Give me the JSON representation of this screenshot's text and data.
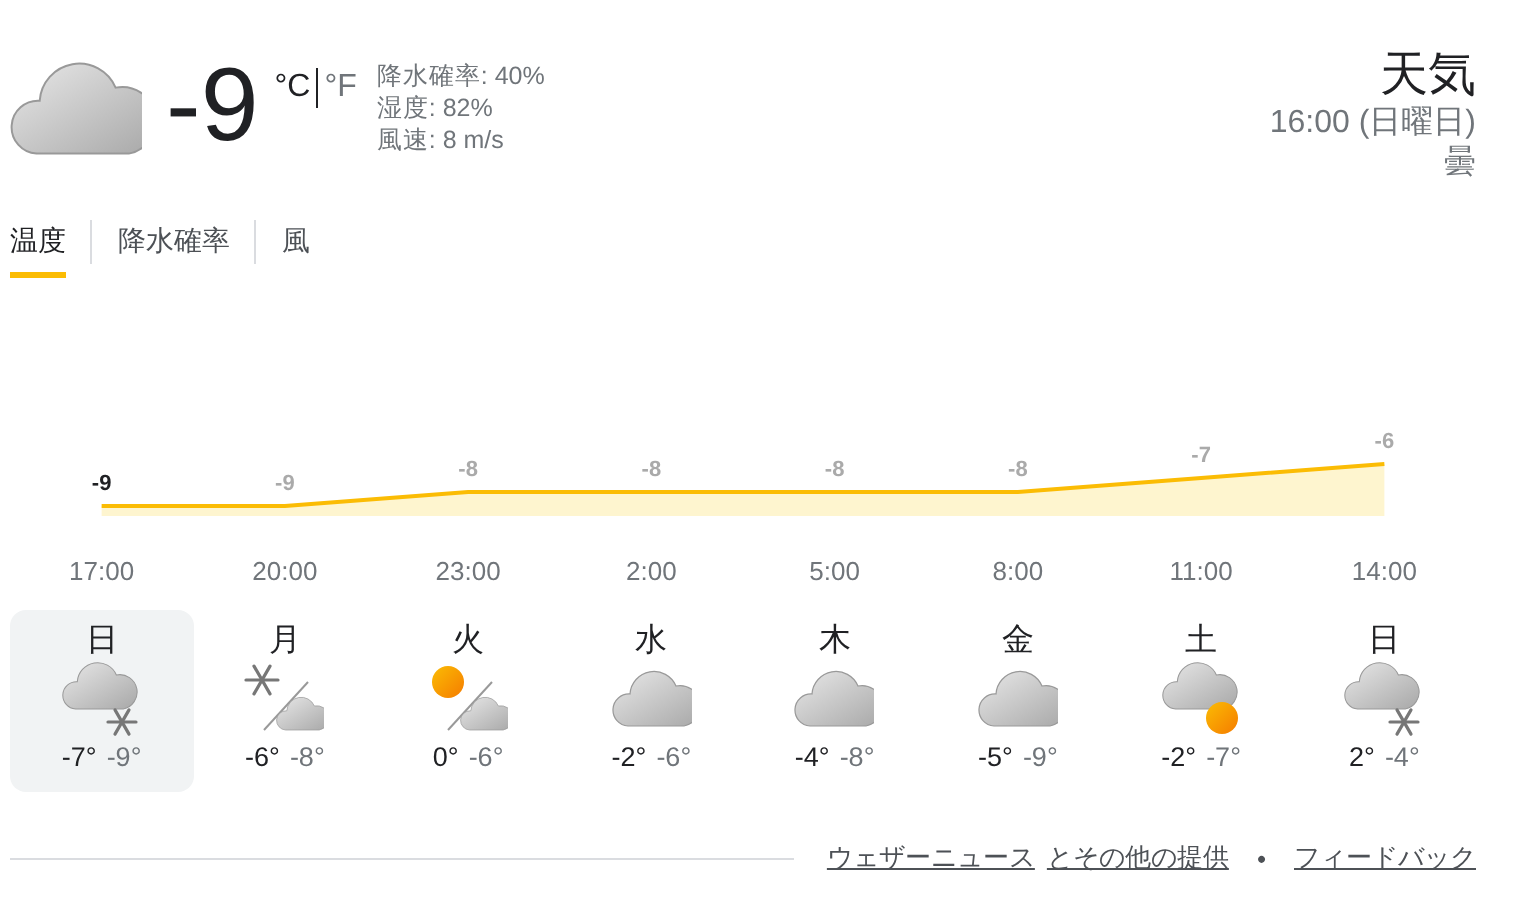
{
  "current": {
    "kind": "cloudy",
    "temperature": "-9",
    "units": [
      {
        "label": "°C",
        "selected": true
      },
      {
        "label": "°F",
        "selected": false
      }
    ],
    "details": [
      "降水確率: 40%",
      "湿度: 82%",
      "風速: 8 m/s"
    ]
  },
  "header": {
    "title": "天気",
    "time": "16:00 (日曜日)",
    "condition": "曇"
  },
  "tabs": [
    {
      "label": "温度",
      "selected": true
    },
    {
      "label": "降水確率",
      "selected": false
    },
    {
      "label": "風",
      "selected": false
    }
  ],
  "chart_data": {
    "type": "area",
    "categories": [
      "17:00",
      "20:00",
      "23:00",
      "2:00",
      "5:00",
      "8:00",
      "11:00",
      "14:00"
    ],
    "values": [
      -9,
      -9,
      -8,
      -8,
      -8,
      -8,
      -7,
      -6
    ],
    "data_labels": true,
    "value_labels": [
      "-9",
      "-9",
      "-8",
      "-8",
      "-8",
      "-8",
      "-7",
      "-6"
    ]
  },
  "days": [
    {
      "day": "日",
      "kind": "cloud_snow",
      "high": "-7°",
      "low": "-9°",
      "selected": true
    },
    {
      "day": "月",
      "kind": "snow_then_cloud",
      "high": "-6°",
      "low": "-8°",
      "selected": false
    },
    {
      "day": "火",
      "kind": "sun_then_cloud",
      "high": "0°",
      "low": "-6°",
      "selected": false
    },
    {
      "day": "水",
      "kind": "cloudy",
      "high": "-2°",
      "low": "-6°",
      "selected": false
    },
    {
      "day": "木",
      "kind": "cloudy",
      "high": "-4°",
      "low": "-8°",
      "selected": false
    },
    {
      "day": "金",
      "kind": "cloudy",
      "high": "-5°",
      "low": "-9°",
      "selected": false
    },
    {
      "day": "土",
      "kind": "cloud_sun",
      "high": "-2°",
      "low": "-7°",
      "selected": false
    },
    {
      "day": "日",
      "kind": "cloud_snow",
      "high": "2°",
      "low": "-4°",
      "selected": false
    }
  ],
  "footer": {
    "links": [
      "ウェザーニュース",
      "とその他の提供",
      "フィードバック"
    ],
    "separator": "•"
  }
}
